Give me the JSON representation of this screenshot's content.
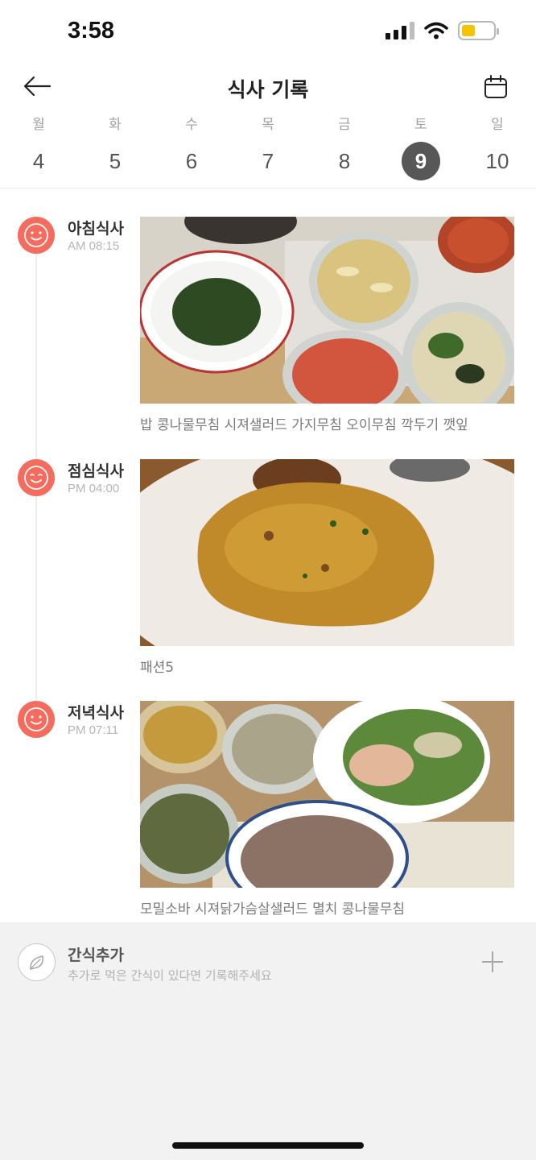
{
  "status_bar": {
    "time": "3:58"
  },
  "header": {
    "title": "식사 기록",
    "back_icon": "arrow-left-icon",
    "calendar_icon": "calendar-icon"
  },
  "week": [
    {
      "name": "월",
      "num": "4",
      "selected": false
    },
    {
      "name": "화",
      "num": "5",
      "selected": false
    },
    {
      "name": "수",
      "num": "6",
      "selected": false
    },
    {
      "name": "목",
      "num": "7",
      "selected": false
    },
    {
      "name": "금",
      "num": "8",
      "selected": false
    },
    {
      "name": "토",
      "num": "9",
      "selected": true
    },
    {
      "name": "일",
      "num": "10",
      "selected": false
    }
  ],
  "meals": [
    {
      "title": "아침식사",
      "time": "AM 08:15",
      "description": "밥 콩나물무침 시져샐러드 가지무침 오이무침 깍두기 깻잎",
      "icon": "smiley-icon"
    },
    {
      "title": "점심식사",
      "time": "PM 04:00",
      "description": "패션5",
      "icon": "smiley-icon"
    },
    {
      "title": "저녁식사",
      "time": "PM 07:11",
      "description": "모밀소바 시져닭가슴살샐러드 멸치 콩나물무침",
      "icon": "smiley-icon"
    }
  ],
  "snack": {
    "title": "간식추가",
    "subtitle": "추가로 먹은 간식이 있다면 기록해주세요",
    "icon": "leaf-icon",
    "add_icon": "plus-icon"
  },
  "colors": {
    "accent": "#f56b5e",
    "selected_day": "#575757"
  }
}
